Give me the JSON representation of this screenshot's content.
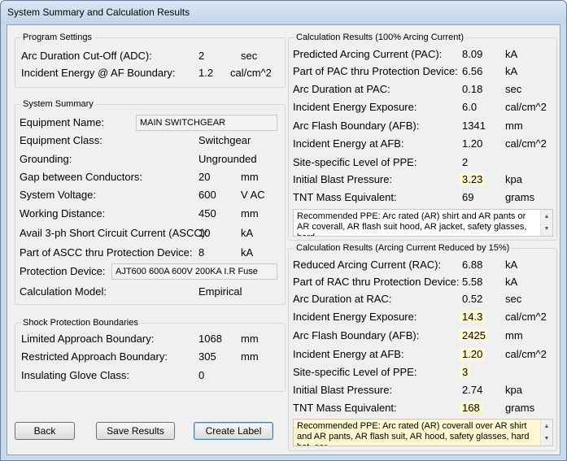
{
  "window": {
    "title": "System Summary and Calculation Results"
  },
  "program_settings": {
    "title": "Program Settings",
    "rows": [
      {
        "label": "Arc Duration Cut-Off (ADC):",
        "value": "2",
        "unit": "sec"
      },
      {
        "label": "Incident Energy @ AF Boundary:",
        "value": "1.2",
        "unit": "cal/cm^2"
      }
    ]
  },
  "system_summary": {
    "title": "System Summary",
    "equipment_name_label": "Equipment Name:",
    "equipment_name_value": "MAIN SWITCHGEAR",
    "equipment_class_label": "Equipment Class:",
    "equipment_class_value": "Switchgear",
    "grounding_label": "Grounding:",
    "grounding_value": "Ungrounded",
    "gap_label": "Gap between Conductors:",
    "gap_value": "20",
    "gap_unit": "mm",
    "voltage_label": "System Voltage:",
    "voltage_value": "600",
    "voltage_unit": "V AC",
    "working_distance_label": "Working Distance:",
    "working_distance_value": "450",
    "working_distance_unit": "mm",
    "ascc_label": "Avail 3-ph Short Circuit Current (ASCC):",
    "ascc_value": "10",
    "ascc_unit": "kA",
    "ascc_thru_label": "Part of ASCC thru Protection Device:",
    "ascc_thru_value": "8",
    "ascc_thru_unit": "kA",
    "protection_device_label": "Protection Device:",
    "protection_device_value": "AJT600 600A 600V 200KA I.R Fuse",
    "calc_model_label": "Calculation Model:",
    "calc_model_value": "Empirical"
  },
  "shock": {
    "title": "Shock Protection Boundaries",
    "rows": [
      {
        "label": "Limited Approach Boundary:",
        "value": "1068",
        "unit": "mm"
      },
      {
        "label": "Restricted Approach Boundary:",
        "value": "305",
        "unit": "mm"
      },
      {
        "label": "Insulating Glove Class:",
        "value": "0",
        "unit": ""
      }
    ]
  },
  "results_100": {
    "title": "Calculation Results (100% Arcing Current)",
    "rows": [
      {
        "label": "Predicted Arcing Current (PAC):",
        "value": "8.09",
        "unit": "kA"
      },
      {
        "label": "Part of PAC thru Protection Device:",
        "value": "6.56",
        "unit": "kA"
      },
      {
        "label": "Arc Duration at PAC:",
        "value": "0.18",
        "unit": "sec"
      },
      {
        "label": "Incident Energy Exposure:",
        "value": "6.0",
        "unit": "cal/cm^2"
      },
      {
        "label": "Arc Flash Boundary (AFB):",
        "value": "1341",
        "unit": "mm"
      },
      {
        "label": "Incident Energy at AFB:",
        "value": "1.20",
        "unit": "cal/cm^2"
      },
      {
        "label": "Site-specific Level of PPE:",
        "value": "2",
        "unit": ""
      },
      {
        "label": "Initial Blast Pressure:",
        "value": "3.23",
        "unit": "kpa"
      },
      {
        "label": "TNT Mass Equivalent:",
        "value": "69",
        "unit": "grams"
      }
    ],
    "ppe_text": "Recommended PPE: Arc rated (AR) shirt and AR pants or AR coverall, AR flash suit hood, AR jacket, safety glasses, hard"
  },
  "results_reduced": {
    "title": "Calculation Results (Arcing Current Reduced by 15%)",
    "rows": [
      {
        "label": "Reduced Arcing Current (RAC):",
        "value": "6.88",
        "unit": "kA"
      },
      {
        "label": "Part of RAC thru Protection Device:",
        "value": "5.58",
        "unit": "kA"
      },
      {
        "label": "Arc Duration at RAC:",
        "value": "0.52",
        "unit": "sec"
      },
      {
        "label": "Incident Energy Exposure:",
        "value": "14.3",
        "unit": "cal/cm^2"
      },
      {
        "label": "Arc Flash Boundary (AFB):",
        "value": "2425",
        "unit": "mm"
      },
      {
        "label": "Incident Energy at AFB:",
        "value": "1.20",
        "unit": "cal/cm^2"
      },
      {
        "label": "Site-specific Level of PPE:",
        "value": "3",
        "unit": ""
      },
      {
        "label": "Initial Blast Pressure:",
        "value": "2.74",
        "unit": "kpa"
      },
      {
        "label": "TNT Mass Equivalent:",
        "value": "168",
        "unit": "grams"
      }
    ],
    "ppe_text": "Recommended PPE: Arc rated (AR) coverall over AR shirt and AR pants, AR flash suit, AR hood, safety glasses, hard hat, ear"
  },
  "buttons": {
    "back": "Back",
    "save": "Save Results",
    "create_label": "Create Label"
  },
  "icons": {
    "scroll_up": "▲",
    "scroll_down": "▼"
  },
  "colors": {
    "highlight": "#fff7cf",
    "window_frame": "#c9d9ec"
  }
}
